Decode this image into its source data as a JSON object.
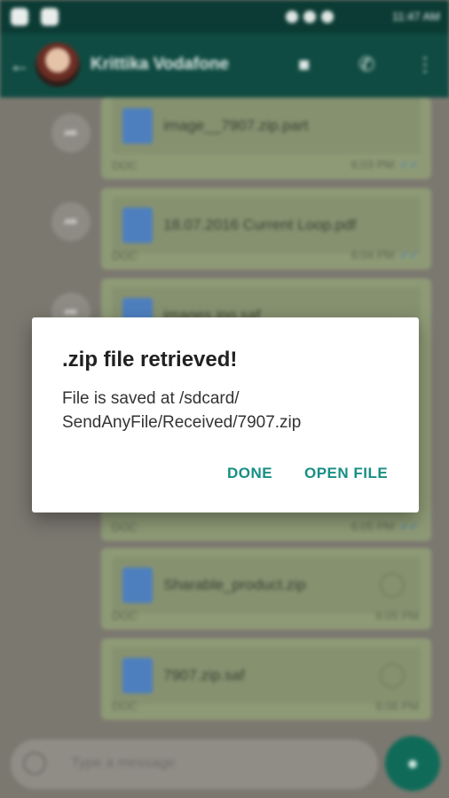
{
  "statusbar": {
    "time": "11:47 AM"
  },
  "header": {
    "contact_name": "Krittika Vodafone"
  },
  "messages": [
    {
      "file_name": "image__7907.zip.part",
      "type": "DOC",
      "time": "6:03 PM"
    },
    {
      "file_name": "18.07.2016 Current Loop.pdf",
      "type": "DOC",
      "time": "6:04 PM"
    },
    {
      "file_name": "images.jpg.saf",
      "type": "DOC",
      "time": "6:05 PM"
    },
    {
      "file_name": "Sharable_product.zip",
      "type": "DOC",
      "time": "6:05 PM"
    },
    {
      "file_name": "7907.zip.saf",
      "type": "DOC",
      "time": "6:06 PM"
    }
  ],
  "compose": {
    "placeholder": "Type a message"
  },
  "dialog": {
    "title": ".zip file retrieved!",
    "message_line1": "File is saved at /sdcard/",
    "message_line2": "SendAnyFile/Received/7907.zip",
    "done_label": "DONE",
    "open_label": "OPEN FILE"
  },
  "colors": {
    "accent": "#178f84",
    "header": "#0f4b42",
    "dialog_bg": "#ffffff"
  }
}
